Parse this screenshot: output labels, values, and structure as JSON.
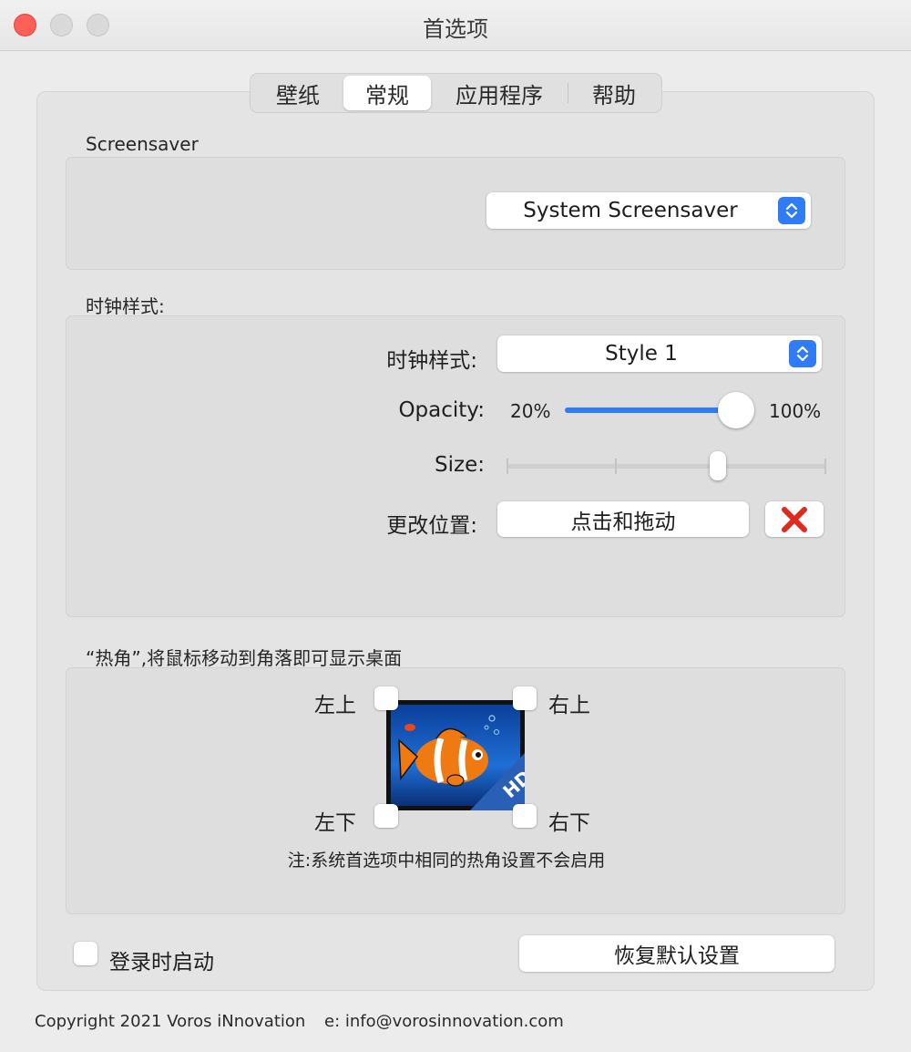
{
  "window": {
    "title": "首选项"
  },
  "tabs": [
    {
      "label": "壁纸"
    },
    {
      "label": "常规"
    },
    {
      "label": "应用程序"
    },
    {
      "label": "帮助"
    }
  ],
  "screensaver": {
    "section_title": "Screensaver",
    "selected": "System Screensaver"
  },
  "clock": {
    "section_title": "时钟样式:",
    "style_label": "时钟样式:",
    "style_selected": "Style 1",
    "opacity_label": "Opacity:",
    "opacity_min": "20%",
    "opacity_max": "100%",
    "opacity_value_percent": 100,
    "size_label": "Size:",
    "size_value_fraction": 0.66,
    "position_label": "更改位置:",
    "position_button": "点击和拖动",
    "reset_icon_name": "red-x-icon"
  },
  "hot_corners": {
    "section_title": "“热角”,将鼠标移动到角落即可显示桌面",
    "top_left": "左上",
    "top_right": "右上",
    "bottom_left": "左下",
    "bottom_right": "右下",
    "note": "注:系统首选项中相同的热角设置不会启用",
    "preview_badge": "HD"
  },
  "footer": {
    "launch_at_login": "登录时启动",
    "restore_defaults": "恢复默认设置",
    "copyright": "Copyright 2021 Voros iNnovation",
    "email": "e: info@vorosinnovation.com"
  },
  "colors": {
    "accent": "#2f7cf6",
    "close_red": "#fe5f57",
    "x_red": "#e0281c"
  }
}
